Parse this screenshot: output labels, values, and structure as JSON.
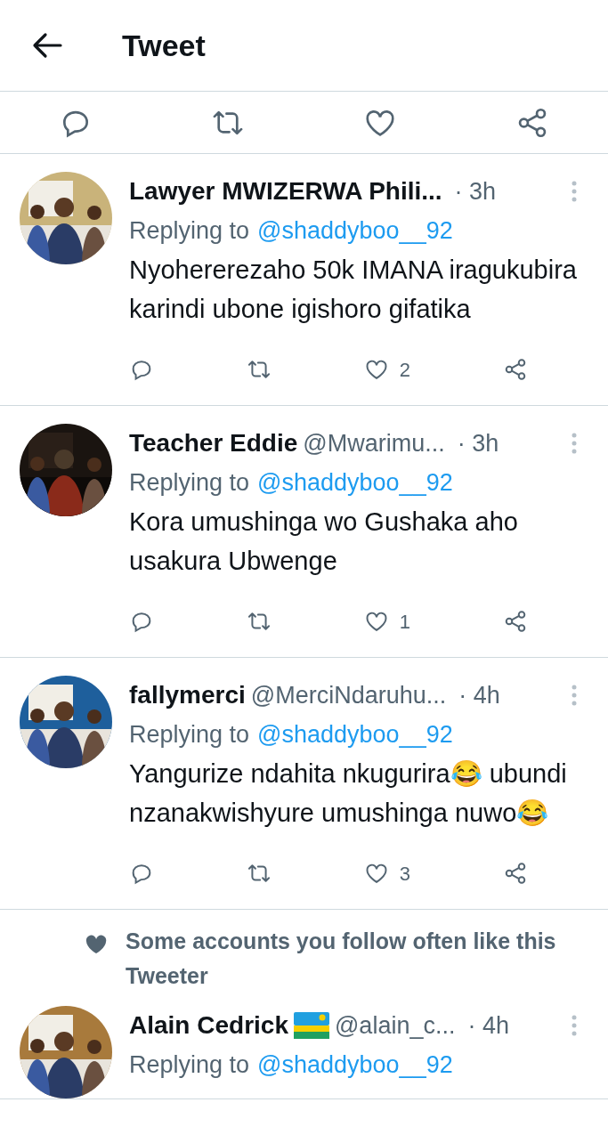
{
  "header": {
    "title": "Tweet"
  },
  "replies": [
    {
      "name": "Lawyer MWIZERWA Phili...",
      "time": "· 3h",
      "replying_label": "Replying to",
      "replying_to": "@shaddyboo__92",
      "body": [
        "Nyohererezaho 50k IMANA iragukubira karindi ubone igishoro gifatika"
      ],
      "likes": "2"
    },
    {
      "name": "Teacher Eddie",
      "handle": "@Mwarimu...",
      "time": "· 3h",
      "replying_label": "Replying to",
      "replying_to": "@shaddyboo__92",
      "body": [
        "Kora umushinga wo Gushaka aho usakura Ubwenge"
      ],
      "likes": "1"
    },
    {
      "name": "fallymerci",
      "handle": "@MerciNdaruhu...",
      "time": "· 4h",
      "replying_label": "Replying to",
      "replying_to": "@shaddyboo__92",
      "body": [
        "Yangurize ndahita nkugurira😂 ubundi nzanakwishyure umushinga nuwo😂"
      ],
      "likes": "3"
    }
  ],
  "social_context": {
    "text": "Some accounts you follow often like this Tweeter"
  },
  "last_reply": {
    "name": "Alain Cedrick",
    "flag": true,
    "handle": "@alain_c...",
    "time": "· 4h",
    "replying_label": "Replying to",
    "replying_to": "@shaddyboo__92"
  }
}
